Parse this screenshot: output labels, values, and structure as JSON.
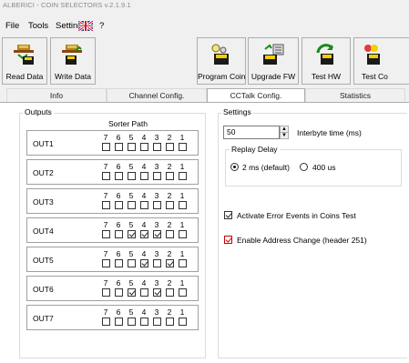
{
  "window": {
    "title": "ALBERICI - COIN SELECTORS v.2.1.9.1"
  },
  "menu": {
    "file": "File",
    "tools": "Tools",
    "settings": "Settings",
    "help": "?"
  },
  "toolbar": {
    "read_data": "Read Data",
    "write_data": "Write Data",
    "program_coin": "Program Coin",
    "upgrade_fw": "Upgrade FW",
    "test_hw": "Test HW",
    "test_coins": "Test Co"
  },
  "tabs": {
    "info": "Info",
    "channel_config": "Channel Config.",
    "cctalk_config": "CCTalk Config.",
    "statistics": "Statistics"
  },
  "outputs": {
    "title": "Outputs",
    "sorter_path": "Sorter Path",
    "bits": [
      "7",
      "6",
      "5",
      "4",
      "3",
      "2",
      "1"
    ],
    "rows": [
      {
        "name": "OUT1",
        "checked": [
          false,
          false,
          false,
          false,
          false,
          false,
          false
        ]
      },
      {
        "name": "OUT2",
        "checked": [
          false,
          false,
          false,
          false,
          false,
          false,
          false
        ]
      },
      {
        "name": "OUT3",
        "checked": [
          false,
          false,
          false,
          false,
          false,
          false,
          false
        ]
      },
      {
        "name": "OUT4",
        "checked": [
          false,
          false,
          true,
          true,
          true,
          false,
          false
        ]
      },
      {
        "name": "OUT5",
        "checked": [
          false,
          false,
          false,
          true,
          false,
          true,
          false
        ]
      },
      {
        "name": "OUT6",
        "checked": [
          false,
          false,
          true,
          false,
          true,
          false,
          false
        ]
      },
      {
        "name": "OUT7",
        "checked": [
          false,
          false,
          false,
          false,
          false,
          false,
          false
        ]
      }
    ]
  },
  "settings": {
    "title": "Settings",
    "interbyte_value": "50",
    "interbyte_label": "Interbyte time (ms)",
    "replay_delay": {
      "title": "Replay Delay",
      "option_2ms": "2 ms (default)",
      "option_400us": "400 us",
      "selected": "2ms"
    },
    "activate_error_events": {
      "label": "Activate Error Events in Coins Test",
      "checked": true
    },
    "enable_address_change": {
      "label": "Enable Address Change (header 251)",
      "checked": true
    }
  }
}
